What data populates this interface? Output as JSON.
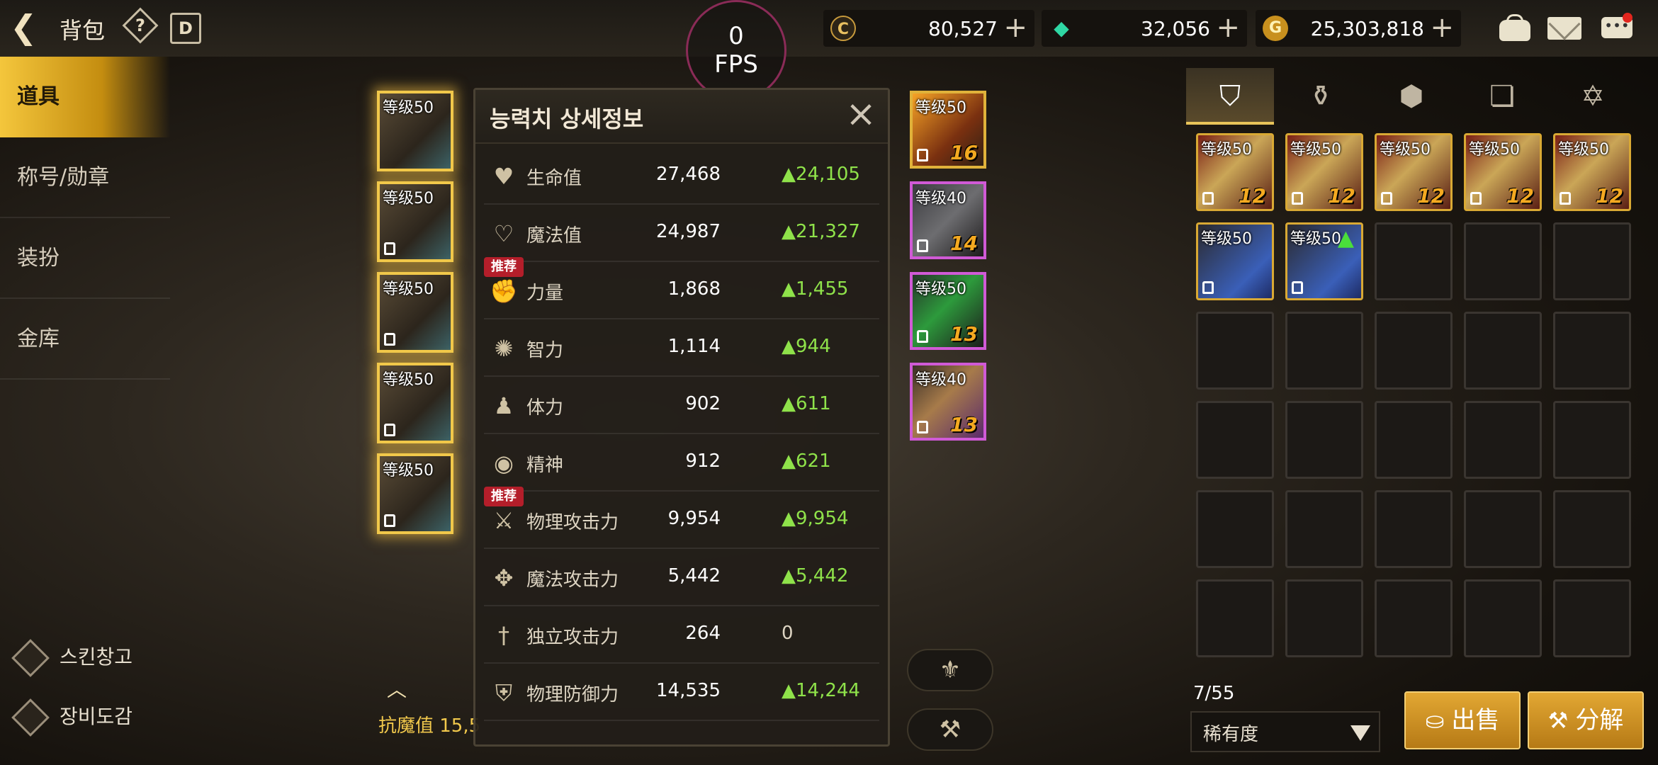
{
  "header": {
    "title": "背包",
    "fps_value": "0",
    "fps_label": "FPS"
  },
  "currencies": [
    {
      "name": "c-coin",
      "symbol": "C",
      "value": "80,527",
      "plus": "+"
    },
    {
      "name": "crystal",
      "symbol": "◆",
      "value": "32,056",
      "plus": "+"
    },
    {
      "name": "gold",
      "symbol": "G",
      "value": "25,303,818",
      "plus": "+"
    }
  ],
  "menu": [
    {
      "label": "道具",
      "active": true
    },
    {
      "label": "称号/勋章"
    },
    {
      "label": "装扮"
    },
    {
      "label": "金库"
    }
  ],
  "bottom_links": [
    "스킨창고",
    "장비도감"
  ],
  "equipped_left": [
    "等级50",
    "等级50",
    "等级50",
    "等级50",
    "等级50"
  ],
  "equipped_right": [
    {
      "level": "等级50",
      "enh": "16"
    },
    {
      "level": "等级40",
      "enh": "14"
    },
    {
      "level": "等级50",
      "enh": "13"
    },
    {
      "level": "等级40",
      "enh": "13"
    }
  ],
  "modal": {
    "title": "능력치 상세정보",
    "recommend": "推荐",
    "rows": [
      {
        "name": "生命值",
        "value": "27,468",
        "inc": "▲24,105"
      },
      {
        "name": "魔法值",
        "value": "24,987",
        "inc": "▲21,327"
      },
      {
        "name": "力量",
        "value": "1,868",
        "inc": "▲1,455"
      },
      {
        "name": "智力",
        "value": "1,114",
        "inc": "▲944"
      },
      {
        "name": "体力",
        "value": "902",
        "inc": "▲611"
      },
      {
        "name": "精神",
        "value": "912",
        "inc": "▲621"
      },
      {
        "name": "物理攻击力",
        "value": "9,954",
        "inc": "▲9,954"
      },
      {
        "name": "魔法攻击力",
        "value": "5,442",
        "inc": "▲5,442"
      },
      {
        "name": "独立攻击力",
        "value": "264",
        "inc": "0"
      },
      {
        "name": "物理防御力",
        "value": "14,535",
        "inc": "▲14,244"
      }
    ]
  },
  "resist": "抗魔值 15,5",
  "inventory": {
    "items": [
      {
        "level": "等级50",
        "enh": "12"
      },
      {
        "level": "等级50",
        "enh": "12"
      },
      {
        "level": "等级50",
        "enh": "12"
      },
      {
        "level": "等级50",
        "enh": "12"
      },
      {
        "level": "等级50",
        "enh": "12"
      },
      {
        "level": "等级50"
      },
      {
        "level": "等级50"
      }
    ],
    "count": "7/55",
    "sort": "稀有度",
    "sell": "出售",
    "decompose": "分解"
  }
}
